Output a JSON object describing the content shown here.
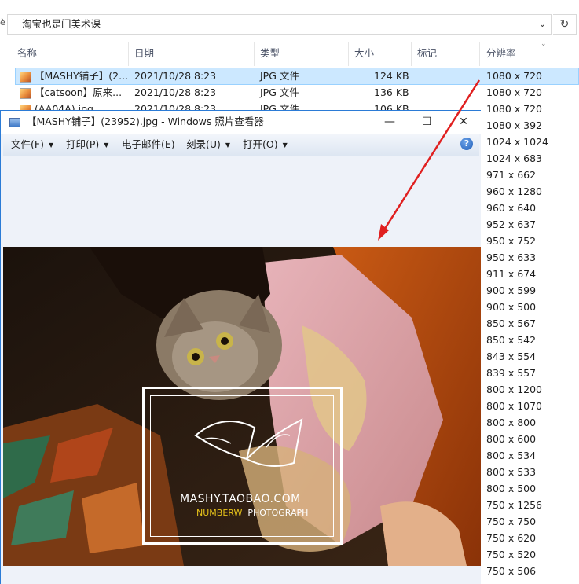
{
  "explorer": {
    "address_edge": "è",
    "path": "淘宝也是门美术课",
    "address_dropdown_icon": "chevron-down-icon",
    "refresh_icon": "↻",
    "columns": [
      "名称",
      "日期",
      "类型",
      "大小",
      "标记",
      "分辨率"
    ],
    "rows": [
      {
        "name": "【MASHY铺子】(2...",
        "date": "2021/10/28 8:23",
        "type": "JPG 文件",
        "size": "124 KB",
        "selected": true
      },
      {
        "name": "【catsoon】原来...",
        "date": "2021/10/28 8:23",
        "type": "JPG 文件",
        "size": "136 KB",
        "selected": false
      },
      {
        "name": "(AA04A).jpg",
        "date": "2021/10/28 8:23",
        "type": "JPG 文件",
        "size": "106 KB",
        "selected": false
      }
    ],
    "resolutions": [
      "1080 x 720",
      "1080 x 720",
      "1080 x 720",
      "1080 x 392",
      "1024 x 1024",
      "1024 x 683",
      "971 x 662",
      "960 x 1280",
      "960 x 640",
      "952 x 637",
      "950 x 752",
      "950 x 633",
      "911 x 674",
      "900 x 599",
      "900 x 500",
      "850 x 567",
      "850 x 542",
      "843 x 554",
      "839 x 557",
      "800 x 1200",
      "800 x 1070",
      "800 x 800",
      "800 x 600",
      "800 x 534",
      "800 x 533",
      "800 x 500",
      "750 x 1256",
      "750 x 750",
      "750 x 620",
      "750 x 520",
      "750 x 506"
    ]
  },
  "viewer": {
    "title": "【MASHY铺子】(23952).jpg - Windows 照片查看器",
    "minimize": "—",
    "maximize": "☐",
    "close": "✕",
    "menu": [
      "文件(F)",
      "打印(P)",
      "电子邮件(E)",
      "刻录(U)",
      "打开(O)"
    ],
    "help": "?",
    "watermark": {
      "signature": "Mei shy",
      "site": "MASHY.TAOBAO.COM",
      "brand_yellow": "NUMBERW",
      "brand_white": "PHOTOGRAPH"
    }
  },
  "colors": {
    "selection": "#cce8ff",
    "window_border": "#2b7bd6",
    "arrow": "#e02020"
  }
}
